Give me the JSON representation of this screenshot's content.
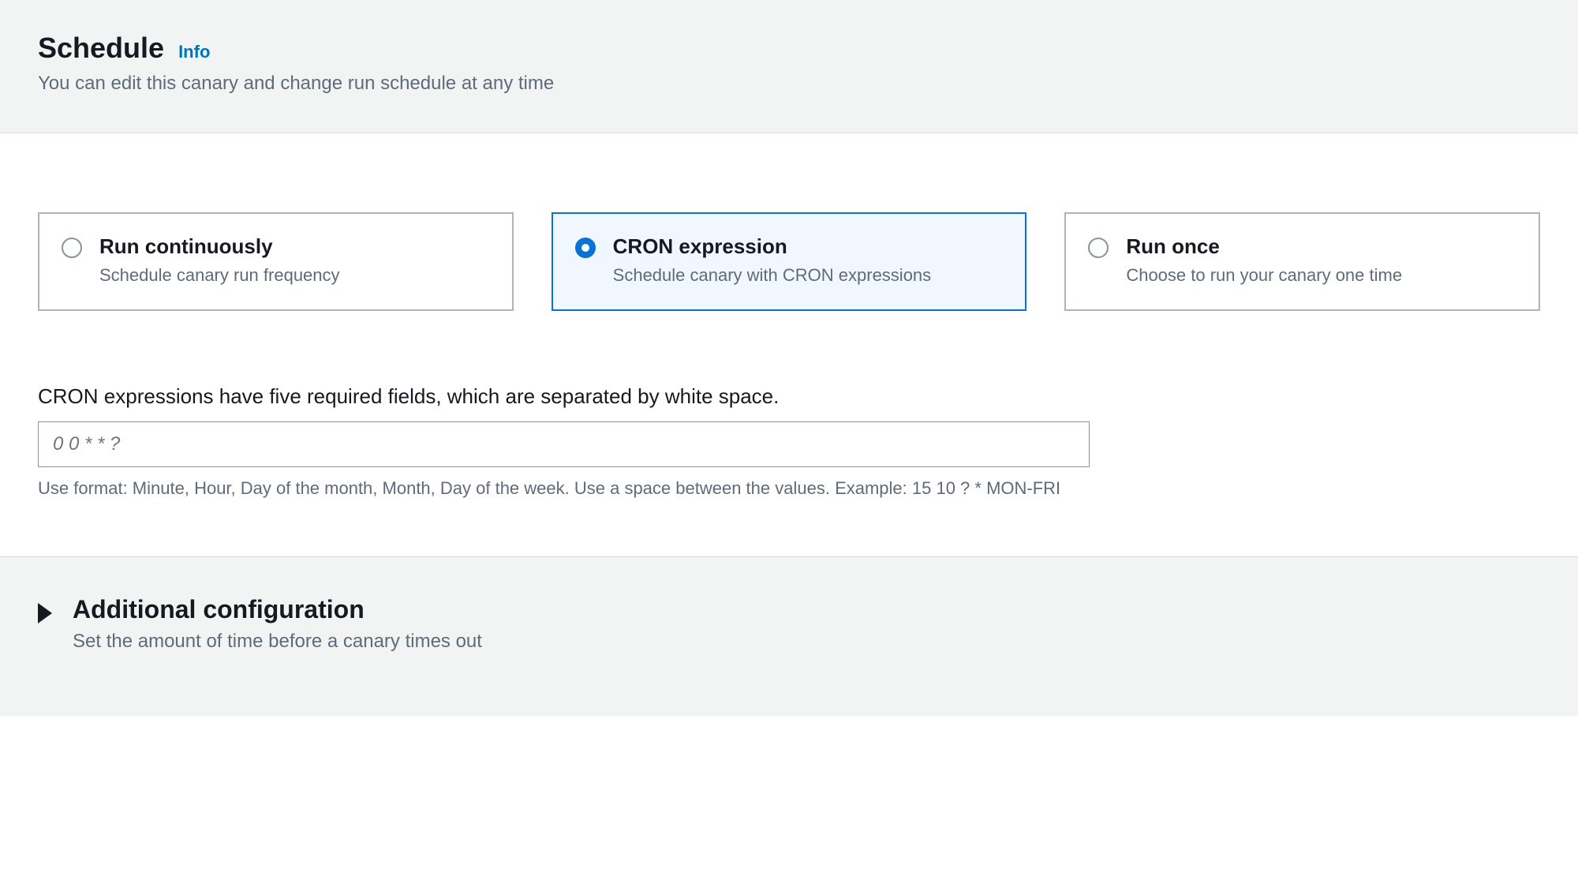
{
  "header": {
    "title": "Schedule",
    "info_label": "Info",
    "subtitle": "You can edit this canary and change run schedule at any time"
  },
  "schedule_options": {
    "selected": "cron",
    "run_continuously": {
      "title": "Run continuously",
      "description": "Schedule canary run frequency"
    },
    "cron": {
      "title": "CRON expression",
      "description": "Schedule canary with CRON expressions"
    },
    "run_once": {
      "title": "Run once",
      "description": "Choose to run your canary one time"
    }
  },
  "cron_field": {
    "label": "CRON expressions have five required fields, which are separated by white space.",
    "placeholder": "0 0 * * ?",
    "value": "",
    "hint": "Use format: Minute, Hour, Day of the month, Month, Day of the week. Use a space between the values. Example: 15 10 ? * MON-FRI"
  },
  "additional_config": {
    "title": "Additional configuration",
    "description": "Set the amount of time before a canary times out",
    "expanded": false
  }
}
